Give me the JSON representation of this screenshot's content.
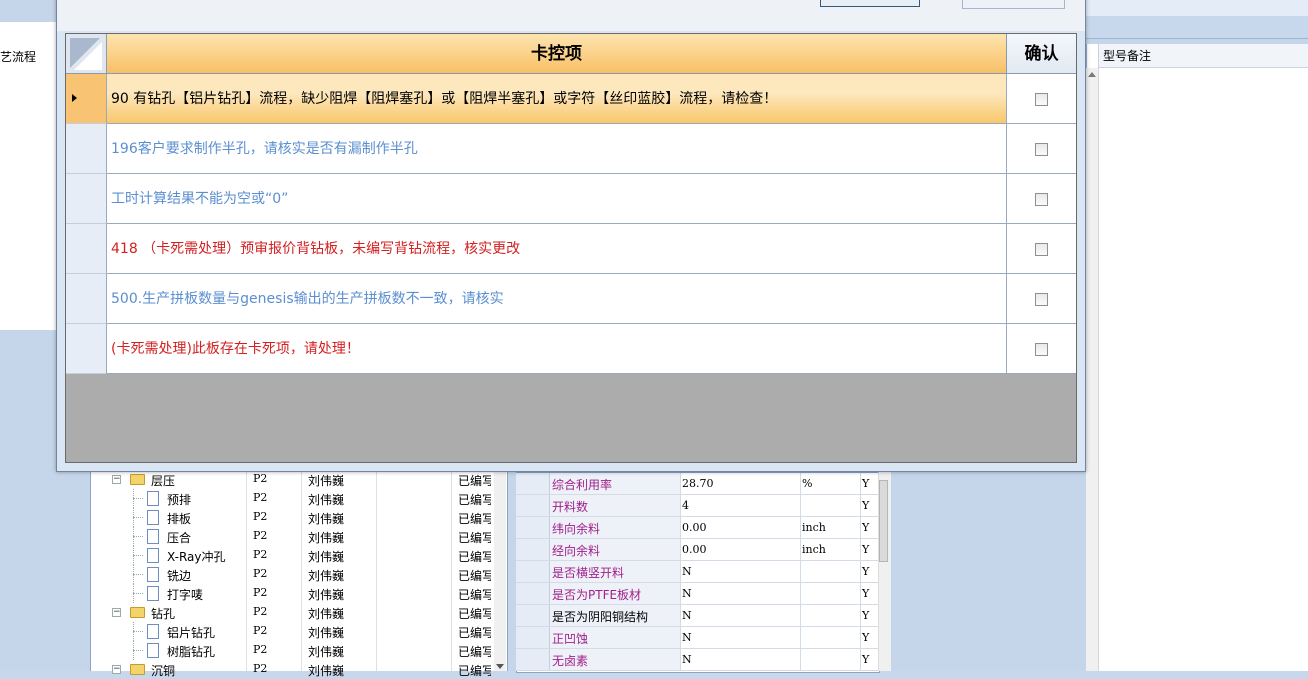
{
  "background": {
    "left_tab_label": "艺流程",
    "right_column_header": "型号备注",
    "tree": [
      {
        "name": "层压",
        "type": "folder",
        "level": 0,
        "expanded": true,
        "p": "P2",
        "user": "刘伟巍",
        "status": "已编写"
      },
      {
        "name": "预排",
        "type": "file",
        "level": 1,
        "p": "P2",
        "user": "刘伟巍",
        "status": "已编写"
      },
      {
        "name": "排板",
        "type": "file",
        "level": 1,
        "p": "P2",
        "user": "刘伟巍",
        "status": "已编写"
      },
      {
        "name": "压合",
        "type": "file",
        "level": 1,
        "p": "P2",
        "user": "刘伟巍",
        "status": "已编写"
      },
      {
        "name": "X-Ray冲孔",
        "type": "file",
        "level": 1,
        "p": "P2",
        "user": "刘伟巍",
        "status": "已编写"
      },
      {
        "name": "铣边",
        "type": "file",
        "level": 1,
        "p": "P2",
        "user": "刘伟巍",
        "status": "已编写"
      },
      {
        "name": "打字唛",
        "type": "file",
        "level": 1,
        "p": "P2",
        "user": "刘伟巍",
        "status": "已编写"
      },
      {
        "name": "钻孔",
        "type": "folder",
        "level": 0,
        "expanded": true,
        "p": "P2",
        "user": "刘伟巍",
        "status": "已编写"
      },
      {
        "name": "铝片钻孔",
        "type": "file",
        "level": 1,
        "p": "P2",
        "user": "刘伟巍",
        "status": "已编写"
      },
      {
        "name": "树脂钻孔",
        "type": "file",
        "level": 1,
        "p": "P2",
        "user": "刘伟巍",
        "status": "已编写"
      },
      {
        "name": "沉铜",
        "type": "folder",
        "level": 0,
        "expanded": true,
        "p": "P2",
        "user": "刘伟巍",
        "status": "已编写"
      }
    ],
    "properties": [
      {
        "name": "综合利用率",
        "value": "28.70",
        "unit": "%",
        "flag": "Y",
        "name_color": "#a0208a"
      },
      {
        "name": "开料数",
        "value": "4",
        "unit": "",
        "flag": "Y",
        "name_color": "#a0208a"
      },
      {
        "name": "纬向余料",
        "value": "0.00",
        "unit": "inch",
        "flag": "Y",
        "name_color": "#a0208a"
      },
      {
        "name": "经向余料",
        "value": "0.00",
        "unit": "inch",
        "flag": "Y",
        "name_color": "#a0208a"
      },
      {
        "name": "是否横竖开料",
        "value": "N",
        "unit": "",
        "flag": "Y",
        "name_color": "#a0208a"
      },
      {
        "name": "是否为PTFE板材",
        "value": "N",
        "unit": "",
        "flag": "Y",
        "name_color": "#a0208a"
      },
      {
        "name": "是否为阴阳铜结构",
        "value": "N",
        "unit": "",
        "flag": "Y",
        "name_color": "#000000"
      },
      {
        "name": "正凹蚀",
        "value": "N",
        "unit": "",
        "flag": "Y",
        "name_color": "#a0208a"
      },
      {
        "name": "无卤素",
        "value": "N",
        "unit": "",
        "flag": "Y",
        "name_color": "#a0208a"
      }
    ]
  },
  "dialog": {
    "grid": {
      "header_item": "卡控项",
      "header_confirm": "确认",
      "rows": [
        {
          "text": "90 有钻孔【铝片钻孔】流程，缺少阻焊【阻焊塞孔】或【阻焊半塞孔】或字符【丝印蓝胶】流程，请检查！",
          "color": "#000000",
          "checked": false,
          "selected": true
        },
        {
          "text": "196客户要求制作半孔，请核实是否有漏制作半孔",
          "color": "#5b8fd0",
          "checked": false,
          "selected": false
        },
        {
          "text": "工时计算结果不能为空或“0”",
          "color": "#5b8fd0",
          "checked": false,
          "selected": false
        },
        {
          "text": "418 （卡死需处理）预审报价背钻板，未编写背钻流程，核实更改",
          "color": "#d42020",
          "checked": false,
          "selected": false
        },
        {
          "text": "500.生产拼板数量与genesis输出的生产拼板数不一致，请核实",
          "color": "#5b8fd0",
          "checked": false,
          "selected": false
        },
        {
          "text": "(卡死需处理)此板存在卡死项，请处理！",
          "color": "#d42020",
          "checked": false,
          "selected": false
        }
      ]
    }
  }
}
